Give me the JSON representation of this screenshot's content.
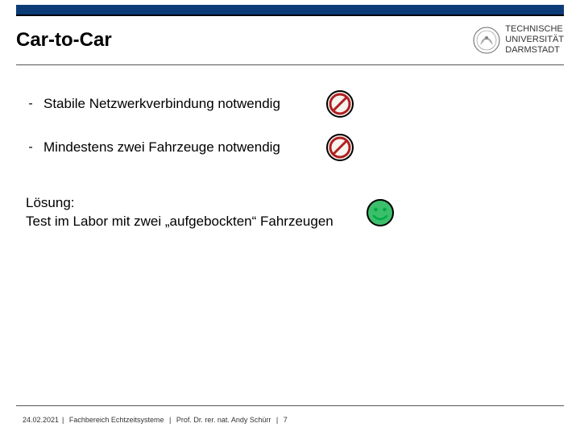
{
  "header": {
    "title": "Car-to-Car",
    "logo": {
      "line1": "TECHNISCHE",
      "line2": "UNIVERSITÄT",
      "line3": "DARMSTADT"
    }
  },
  "bullets": [
    {
      "text": "Stabile Netzwerkverbindung notwendig",
      "icon": "prohibited-icon"
    },
    {
      "text": "Mindestens zwei Fahrzeuge notwendig",
      "icon": "prohibited-icon"
    }
  ],
  "solution": {
    "label": "Lösung:",
    "body": "Test im Labor mit zwei „aufgebockten“ Fahrzeugen",
    "icon": "smiley-icon"
  },
  "footer": {
    "date": "24.02.2021",
    "department": "Fachbereich Echtzeitsysteme",
    "author": "Prof. Dr. rer. nat. Andy Schürr",
    "page": "7"
  },
  "colors": {
    "brand_blue": "#0c3c78",
    "prohibit_red": "#b02020",
    "smiley_green": "#3bbf6b"
  }
}
